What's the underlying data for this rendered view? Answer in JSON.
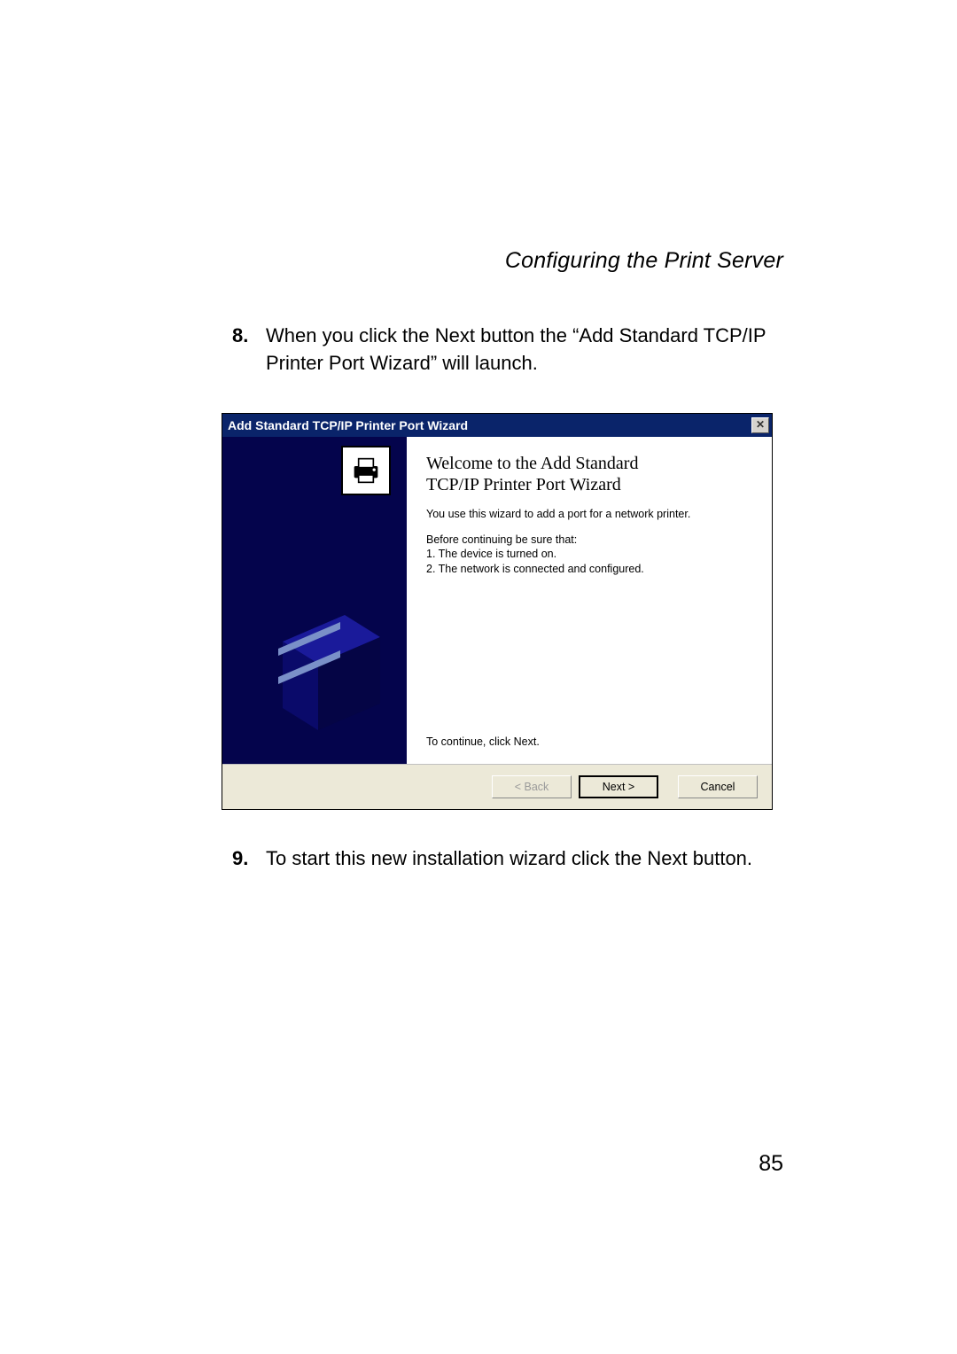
{
  "header": {
    "section_title": "Configuring the Print Server"
  },
  "steps": {
    "s8": {
      "num": "8.",
      "text": "When you click the Next button the “Add Standard TCP/IP Printer Port Wizard” will launch."
    },
    "s9": {
      "num": "9.",
      "text": "To start this new installation wizard click the Next button."
    }
  },
  "dialog": {
    "title": "Add Standard TCP/IP Printer Port Wizard",
    "close_glyph": "✕",
    "heading_l1": "Welcome to the Add Standard",
    "heading_l2": "TCP/IP Printer Port Wizard",
    "intro": "You use this wizard to add a port for a network printer.",
    "before_line": "Before continuing be sure that:",
    "item1": "1.  The device is turned on.",
    "item2": "2.  The network is connected and configured.",
    "continue": "To continue, click Next.",
    "buttons": {
      "back": "< Back",
      "next": "Next >",
      "cancel": "Cancel"
    }
  },
  "page_number": "85"
}
